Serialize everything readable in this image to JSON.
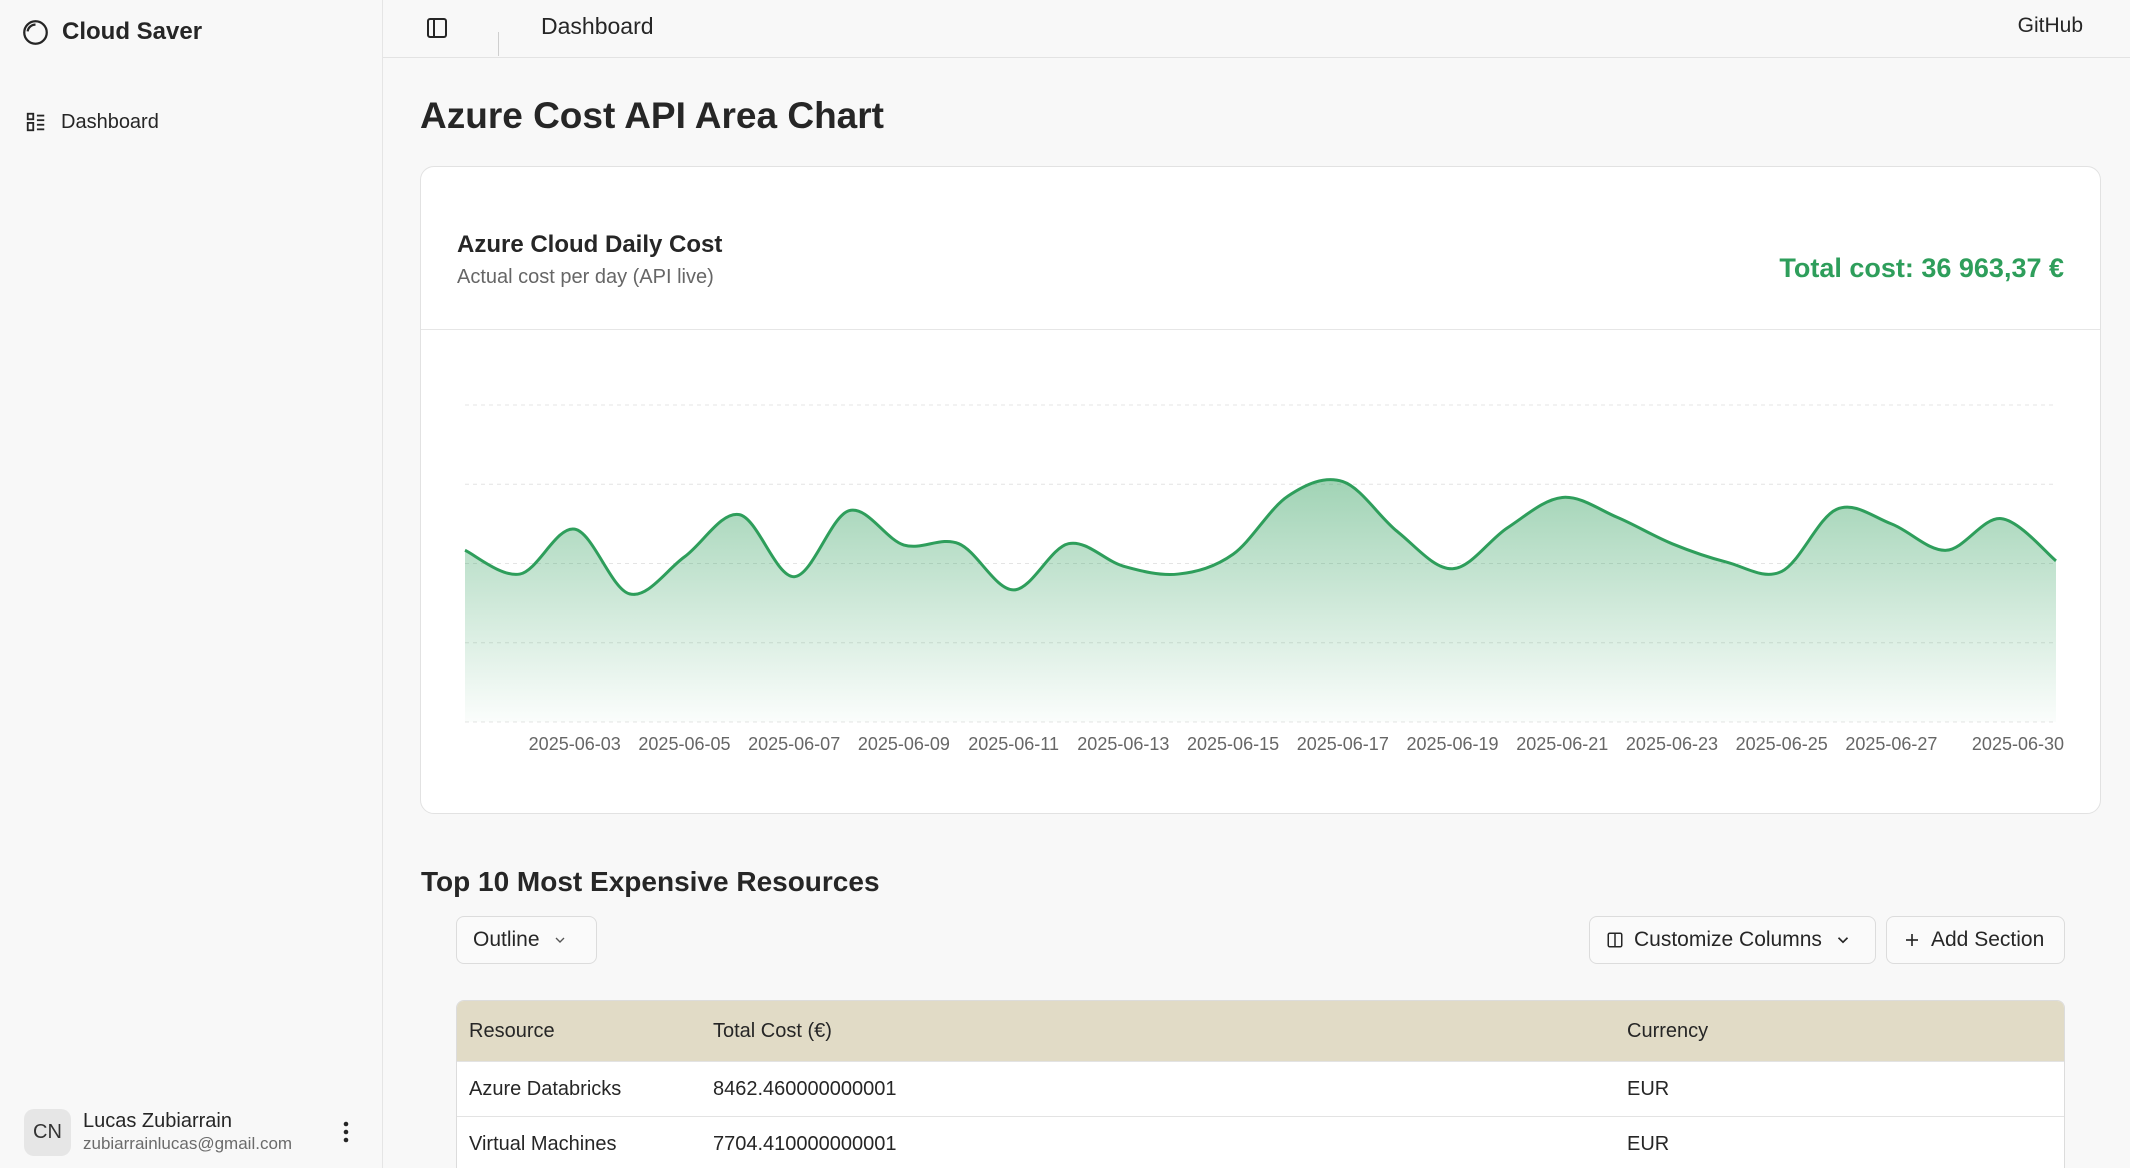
{
  "app": {
    "brand": "Cloud Saver"
  },
  "sidebar": {
    "items": [
      {
        "label": "Dashboard",
        "icon": "list-dashboard-icon"
      }
    ],
    "user": {
      "initials": "CN",
      "name": "Lucas Zubiarrain",
      "email": "zubiarrainlucas@gmail.com"
    }
  },
  "topbar": {
    "breadcrumb": "Dashboard",
    "github_label": "GitHub"
  },
  "page": {
    "title": "Azure Cost API Area Chart"
  },
  "card": {
    "title": "Azure Cloud Daily Cost",
    "subtitle": "Actual cost per day (API live)",
    "total_label": "Total cost: 36 963,37 €"
  },
  "colors": {
    "accent": "#2e9e5b",
    "table_header": "#e1dbc6"
  },
  "chart_data": {
    "type": "area",
    "title": "Azure Cloud Daily Cost",
    "x": [
      "2025-06-01",
      "2025-06-02",
      "2025-06-03",
      "2025-06-04",
      "2025-06-05",
      "2025-06-06",
      "2025-06-07",
      "2025-06-08",
      "2025-06-09",
      "2025-06-10",
      "2025-06-11",
      "2025-06-12",
      "2025-06-13",
      "2025-06-14",
      "2025-06-15",
      "2025-06-16",
      "2025-06-17",
      "2025-06-18",
      "2025-06-19",
      "2025-06-20",
      "2025-06-21",
      "2025-06-22",
      "2025-06-23",
      "2025-06-24",
      "2025-06-25",
      "2025-06-26",
      "2025-06-27",
      "2025-06-28",
      "2025-06-29",
      "2025-06-30"
    ],
    "tick_labels": [
      "2025-06-03",
      "2025-06-05",
      "2025-06-07",
      "2025-06-09",
      "2025-06-11",
      "2025-06-13",
      "2025-06-15",
      "2025-06-17",
      "2025-06-19",
      "2025-06-21",
      "2025-06-23",
      "2025-06-25",
      "2025-06-27",
      "2025-06-30"
    ],
    "values": [
      1300,
      1120,
      1460,
      970,
      1250,
      1570,
      1100,
      1600,
      1340,
      1350,
      1000,
      1350,
      1180,
      1120,
      1270,
      1710,
      1820,
      1440,
      1160,
      1470,
      1700,
      1550,
      1350,
      1210,
      1140,
      1610,
      1500,
      1300,
      1540,
      1220
    ],
    "ylim": [
      0,
      2400
    ],
    "grid": true,
    "legend": "none"
  },
  "table": {
    "section_title": "Top 10 Most Expensive Resources",
    "view_select": "Outline",
    "customize_label": "Customize Columns",
    "add_section_label": "Add Section",
    "columns": [
      "Resource",
      "Total Cost (€)",
      "Currency"
    ],
    "rows": [
      [
        "Azure Databricks",
        "8462.460000000001",
        "EUR"
      ],
      [
        "Virtual Machines",
        "7704.410000000001",
        "EUR"
      ]
    ]
  }
}
